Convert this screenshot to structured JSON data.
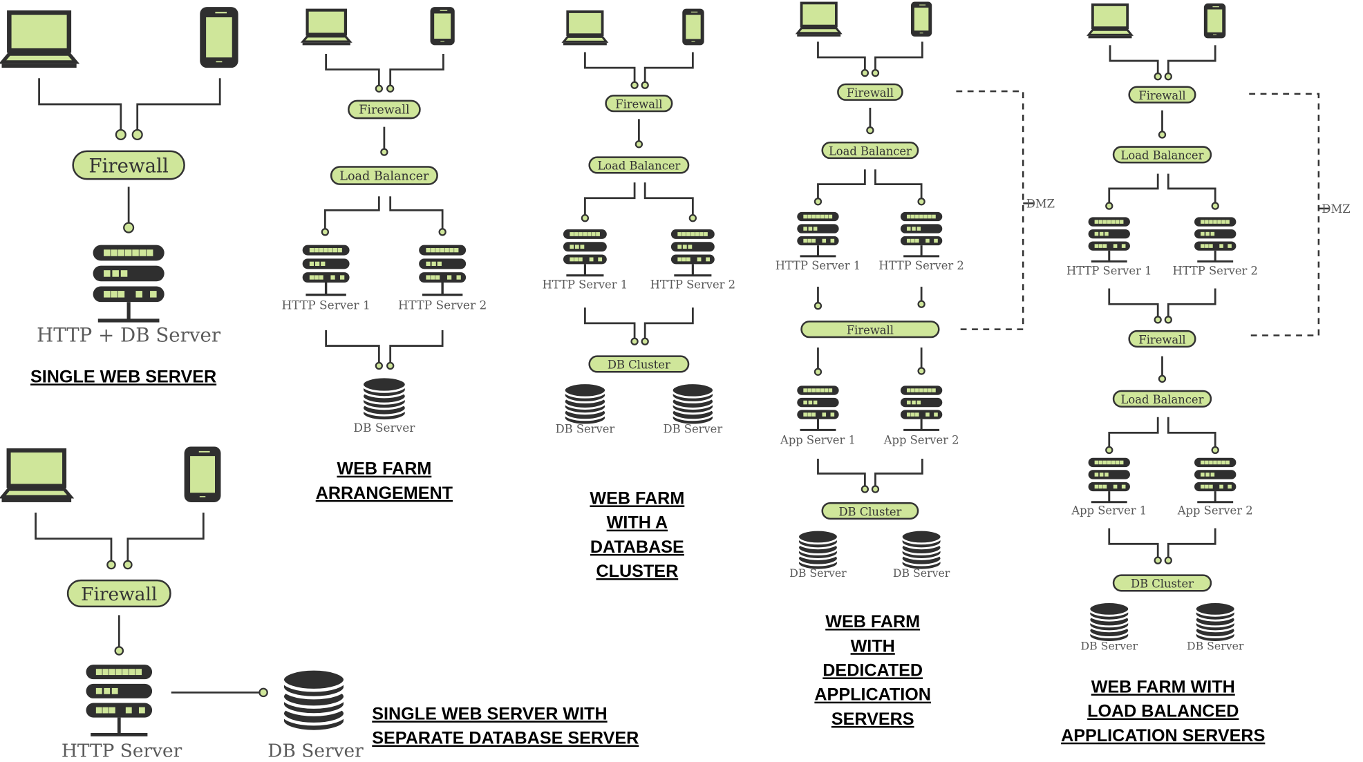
{
  "colors": {
    "accent_green": "#cfe69a",
    "dark": "#2f2f2f",
    "line": "#333333",
    "label": "#5a5a5a"
  },
  "icons": [
    "laptop-icon",
    "smartphone-icon",
    "server-icon",
    "database-icon"
  ],
  "diagrams": [
    {
      "title_lines": [
        "SINGLE WEB SERVER"
      ],
      "nodes": {
        "firewall": "Firewall",
        "server": "HTTP + DB Server"
      }
    },
    {
      "title_lines": [
        "WEB FARM ",
        "ARRANGEMENT"
      ],
      "nodes": {
        "firewall": "Firewall",
        "load_balancer": "Load Balancer",
        "http1": "HTTP Server 1",
        "http2": "HTTP Server 2",
        "db": "DB Server"
      }
    },
    {
      "title_lines": [
        "WEB FARM ",
        "WITH A ",
        "DATABASE ",
        "CLUSTER"
      ],
      "nodes": {
        "firewall": "Firewall",
        "load_balancer": "Load Balancer",
        "http1": "HTTP Server 1",
        "http2": "HTTP Server 2",
        "db_cluster": "DB Cluster",
        "db1": "DB Server",
        "db2": "DB Server"
      }
    },
    {
      "title_lines": [
        "WEB FARM ",
        "WITH ",
        "DEDICATED ",
        "APPLICATION ",
        "SERVERS"
      ],
      "nodes": {
        "firewall": "Firewall",
        "load_balancer": "Load Balancer",
        "http1": "HTTP Server 1",
        "http2": "HTTP Server 2",
        "firewall2": "Firewall",
        "app1": "App Server 1",
        "app2": "App Server 2",
        "db_cluster": "DB Cluster",
        "db1": "DB Server",
        "db2": "DB Server",
        "dmz": "DMZ"
      }
    },
    {
      "title_lines": [
        "WEB FARM WITH ",
        "LOAD BALANCED ",
        "APPLICATION SERVERS"
      ],
      "nodes": {
        "firewall": "Firewall",
        "load_balancer": "Load Balancer",
        "http1": "HTTP Server 1",
        "http2": "HTTP Server 2",
        "firewall2": "Firewall",
        "load_balancer2": "Load Balancer",
        "app1": "App Server 1",
        "app2": "App Server 2",
        "db_cluster": "DB Cluster",
        "db1": "DB Server",
        "db2": "DB Server",
        "dmz": "DMZ"
      }
    },
    {
      "title_lines": [
        "SINGLE WEB SERVER WITH ",
        "SEPARATE DATABASE SERVER"
      ],
      "nodes": {
        "firewall": "Firewall",
        "server": "HTTP Server",
        "db": "DB Server"
      }
    }
  ]
}
